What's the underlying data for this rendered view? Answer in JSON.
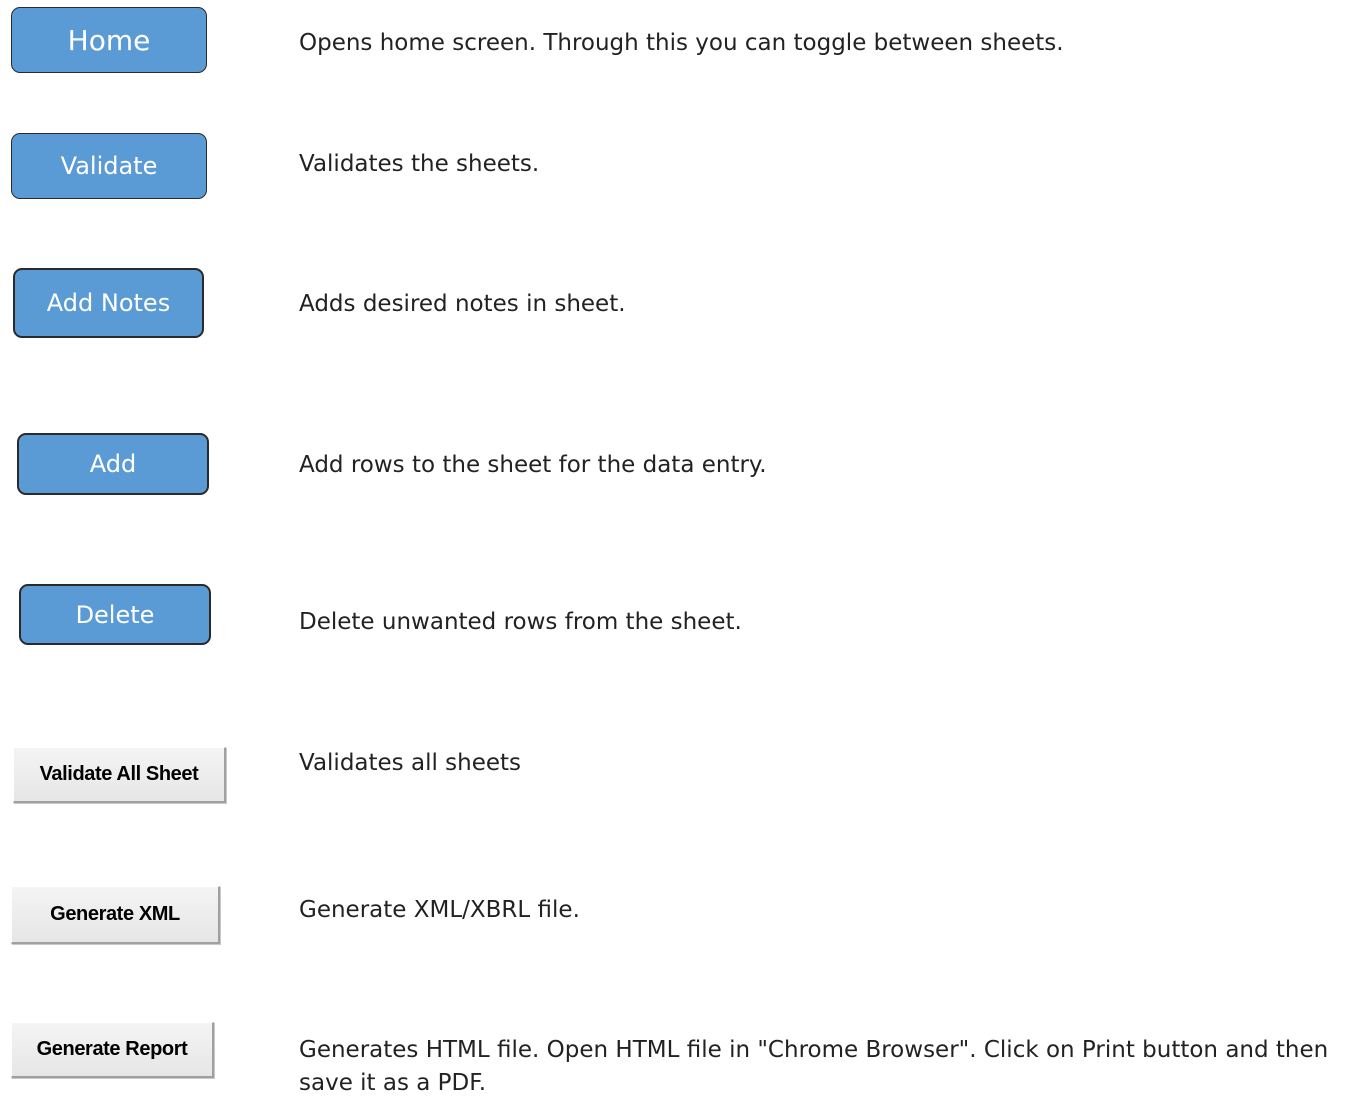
{
  "items": [
    {
      "button": "Home",
      "description": "Opens home screen. Through this you can toggle between sheets."
    },
    {
      "button": "Validate",
      "description": "Validates the sheets."
    },
    {
      "button": "Add Notes",
      "description": "Adds desired notes in sheet."
    },
    {
      "button": "Add",
      "description": "Add rows to the sheet for the data entry."
    },
    {
      "button": "Delete",
      "description": "Delete unwanted rows from the sheet."
    },
    {
      "button": "Validate All Sheet",
      "description": "Validates all sheets"
    },
    {
      "button": "Generate XML",
      "description": "Generate XML/XBRL file."
    },
    {
      "button": "Generate Report",
      "description": "Generates HTML file. Open HTML file in \"Chrome Browser\". Click on Print button and then save it as a PDF."
    }
  ],
  "colors": {
    "button_blue": "#5b9bd5",
    "button_gray": "#ececec"
  }
}
